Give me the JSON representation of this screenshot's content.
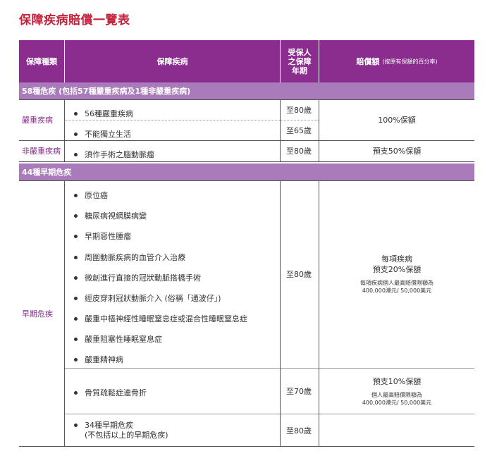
{
  "title": "保障疾病賠償一覽表",
  "header": {
    "col1": "保障種類",
    "col2": "保障疾病",
    "col3_l1": "受保人",
    "col3_l2": "之保障",
    "col3_l3": "年期",
    "col4_main": "賠償額",
    "col4_note": "(按原有保額的百分率)"
  },
  "band58": "58種危疾 (包括57種嚴重疾病及1種非嚴重疾病)",
  "band44": "44種早期危疾",
  "serious": {
    "category": "嚴重疾病",
    "items": [
      "56種嚴重疾病",
      "不能獨立生活"
    ],
    "terms": [
      "至80歲",
      "至65歲"
    ],
    "payout": "100%保額"
  },
  "nonserious": {
    "category": "非嚴重疾病",
    "item": "須作手術之腦動脈瘤",
    "term": "至80歲",
    "payout": "預支50%保額"
  },
  "early": {
    "category": "早期危疾",
    "items": [
      "原位癌",
      "糖尿病視網膜病變",
      "早期惡性腫瘤",
      "周圍動脈疾病的血管介入治療",
      "微創進行直接的冠狀動脈搭橋手術",
      "經皮穿刺冠狀動脈介入 (俗稱「通波仔」)",
      "嚴重中樞神經性睡眠窒息症或混合性睡眠窒息症",
      "嚴重阻塞性睡眠窒息症",
      "嚴重精神病"
    ],
    "term": "至80歲",
    "payout_l1": "每項疾病",
    "payout_l2": "預支20%保額",
    "payout_note_l1": "每項疾病個人最高賠償限額為",
    "payout_note_l2": "400,000港元/ 50,000美元",
    "osteo_item": "骨質疏鬆症連骨折",
    "osteo_term": "至70歲",
    "osteo_payout": "預支10%保額",
    "osteo_note_l1": "個人最高賠償限額為",
    "osteo_note_l2": "400,000港元/ 50,000美元",
    "other_item_l1": "34種早期危疾",
    "other_item_l2": "(不包括以上的早期危疾)",
    "other_term": "至80歲"
  },
  "colors": {
    "title": "#c4233b",
    "header": "#8a2d8e",
    "band": "#a97bba",
    "category": "#8a2d8e"
  }
}
